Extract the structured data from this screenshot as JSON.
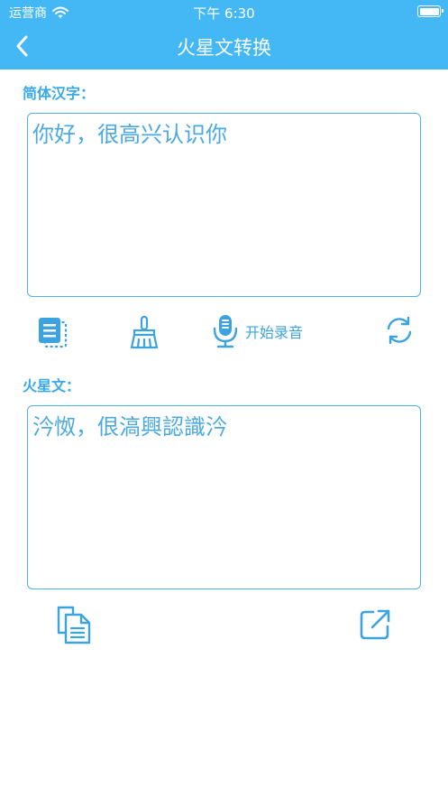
{
  "status_bar": {
    "carrier": "运营商",
    "time": "下午 6:30"
  },
  "nav": {
    "title": "火星文转换",
    "back_icon": "chevron-left-icon"
  },
  "source": {
    "label": "简体汉字：",
    "text": "你好，很高兴认识你"
  },
  "source_toolbar": {
    "paste_icon": "paste-icon",
    "clear_icon": "broom-icon",
    "mic_icon": "microphone-icon",
    "record_label": "开始录音",
    "convert_icon": "refresh-icon"
  },
  "target": {
    "label": "火星文：",
    "text": "汵怓，佷滈興認識汵"
  },
  "target_toolbar": {
    "copy_icon": "copy-icon",
    "share_icon": "share-icon"
  },
  "colors": {
    "header": "#43b8f5",
    "accent": "#3aa3e0",
    "border": "#4fb3ea"
  }
}
